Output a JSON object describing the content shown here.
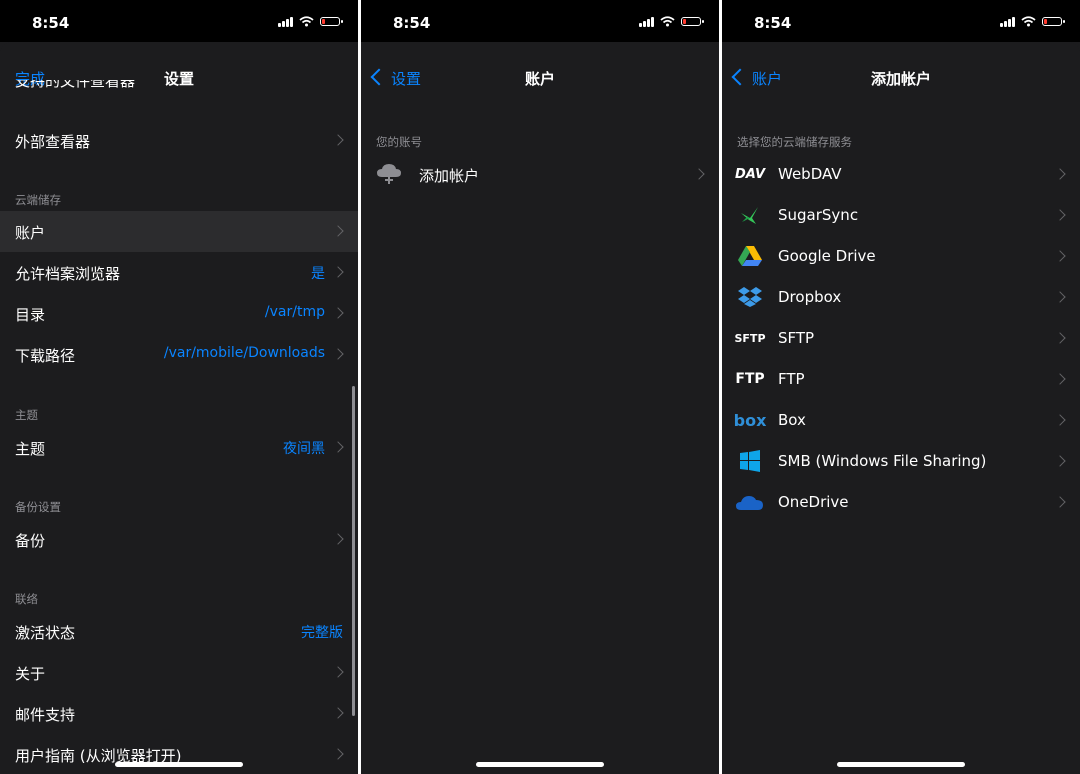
{
  "status": {
    "time": "8:54"
  },
  "panel1": {
    "nav": {
      "done": "完成",
      "title": "设置"
    },
    "top_clipped_label": "支持的文件查看器",
    "external_viewer": "外部查看器",
    "sections": {
      "cloud": "云端储存",
      "theme": "主题",
      "backup": "备份设置",
      "contact": "联络"
    },
    "rows": {
      "account": "账户",
      "allow_browser": {
        "label": "允许档案浏览器",
        "value": "是"
      },
      "directory": {
        "label": "目录",
        "value": "/var/tmp"
      },
      "download_path": {
        "label": "下载路径",
        "value": "/var/mobile/Downloads"
      },
      "theme": {
        "label": "主题",
        "value": "夜间黑"
      },
      "backup": "备份",
      "activation": {
        "label": "激活状态",
        "value": "完整版"
      },
      "about": "关于",
      "mail": "邮件支持",
      "guide": "用户指南 (从浏览器打开)"
    }
  },
  "panel2": {
    "nav": {
      "back": "设置",
      "title": "账户"
    },
    "header": "您的账号",
    "add_account": "添加帐户"
  },
  "panel3": {
    "nav": {
      "back": "账户",
      "title": "添加帐户"
    },
    "header": "选择您的云端储存服务",
    "services": [
      {
        "name": "WebDAV",
        "icon": "webdav-icon"
      },
      {
        "name": "SugarSync",
        "icon": "sugarsync-icon"
      },
      {
        "name": "Google Drive",
        "icon": "google-drive-icon"
      },
      {
        "name": "Dropbox",
        "icon": "dropbox-icon"
      },
      {
        "name": "SFTP",
        "icon": "sftp-icon"
      },
      {
        "name": "FTP",
        "icon": "ftp-icon"
      },
      {
        "name": "Box",
        "icon": "box-icon"
      },
      {
        "name": "SMB (Windows File Sharing)",
        "icon": "windows-icon"
      },
      {
        "name": "OneDrive",
        "icon": "onedrive-icon"
      }
    ],
    "icon_text": {
      "webdav": "DAV",
      "sftp": "SFTP",
      "ftp": "FTP",
      "box": "box"
    }
  },
  "colors": {
    "accent": "#0a84ff",
    "background": "#1c1c1e",
    "row_selected": "#2c2c2e"
  }
}
